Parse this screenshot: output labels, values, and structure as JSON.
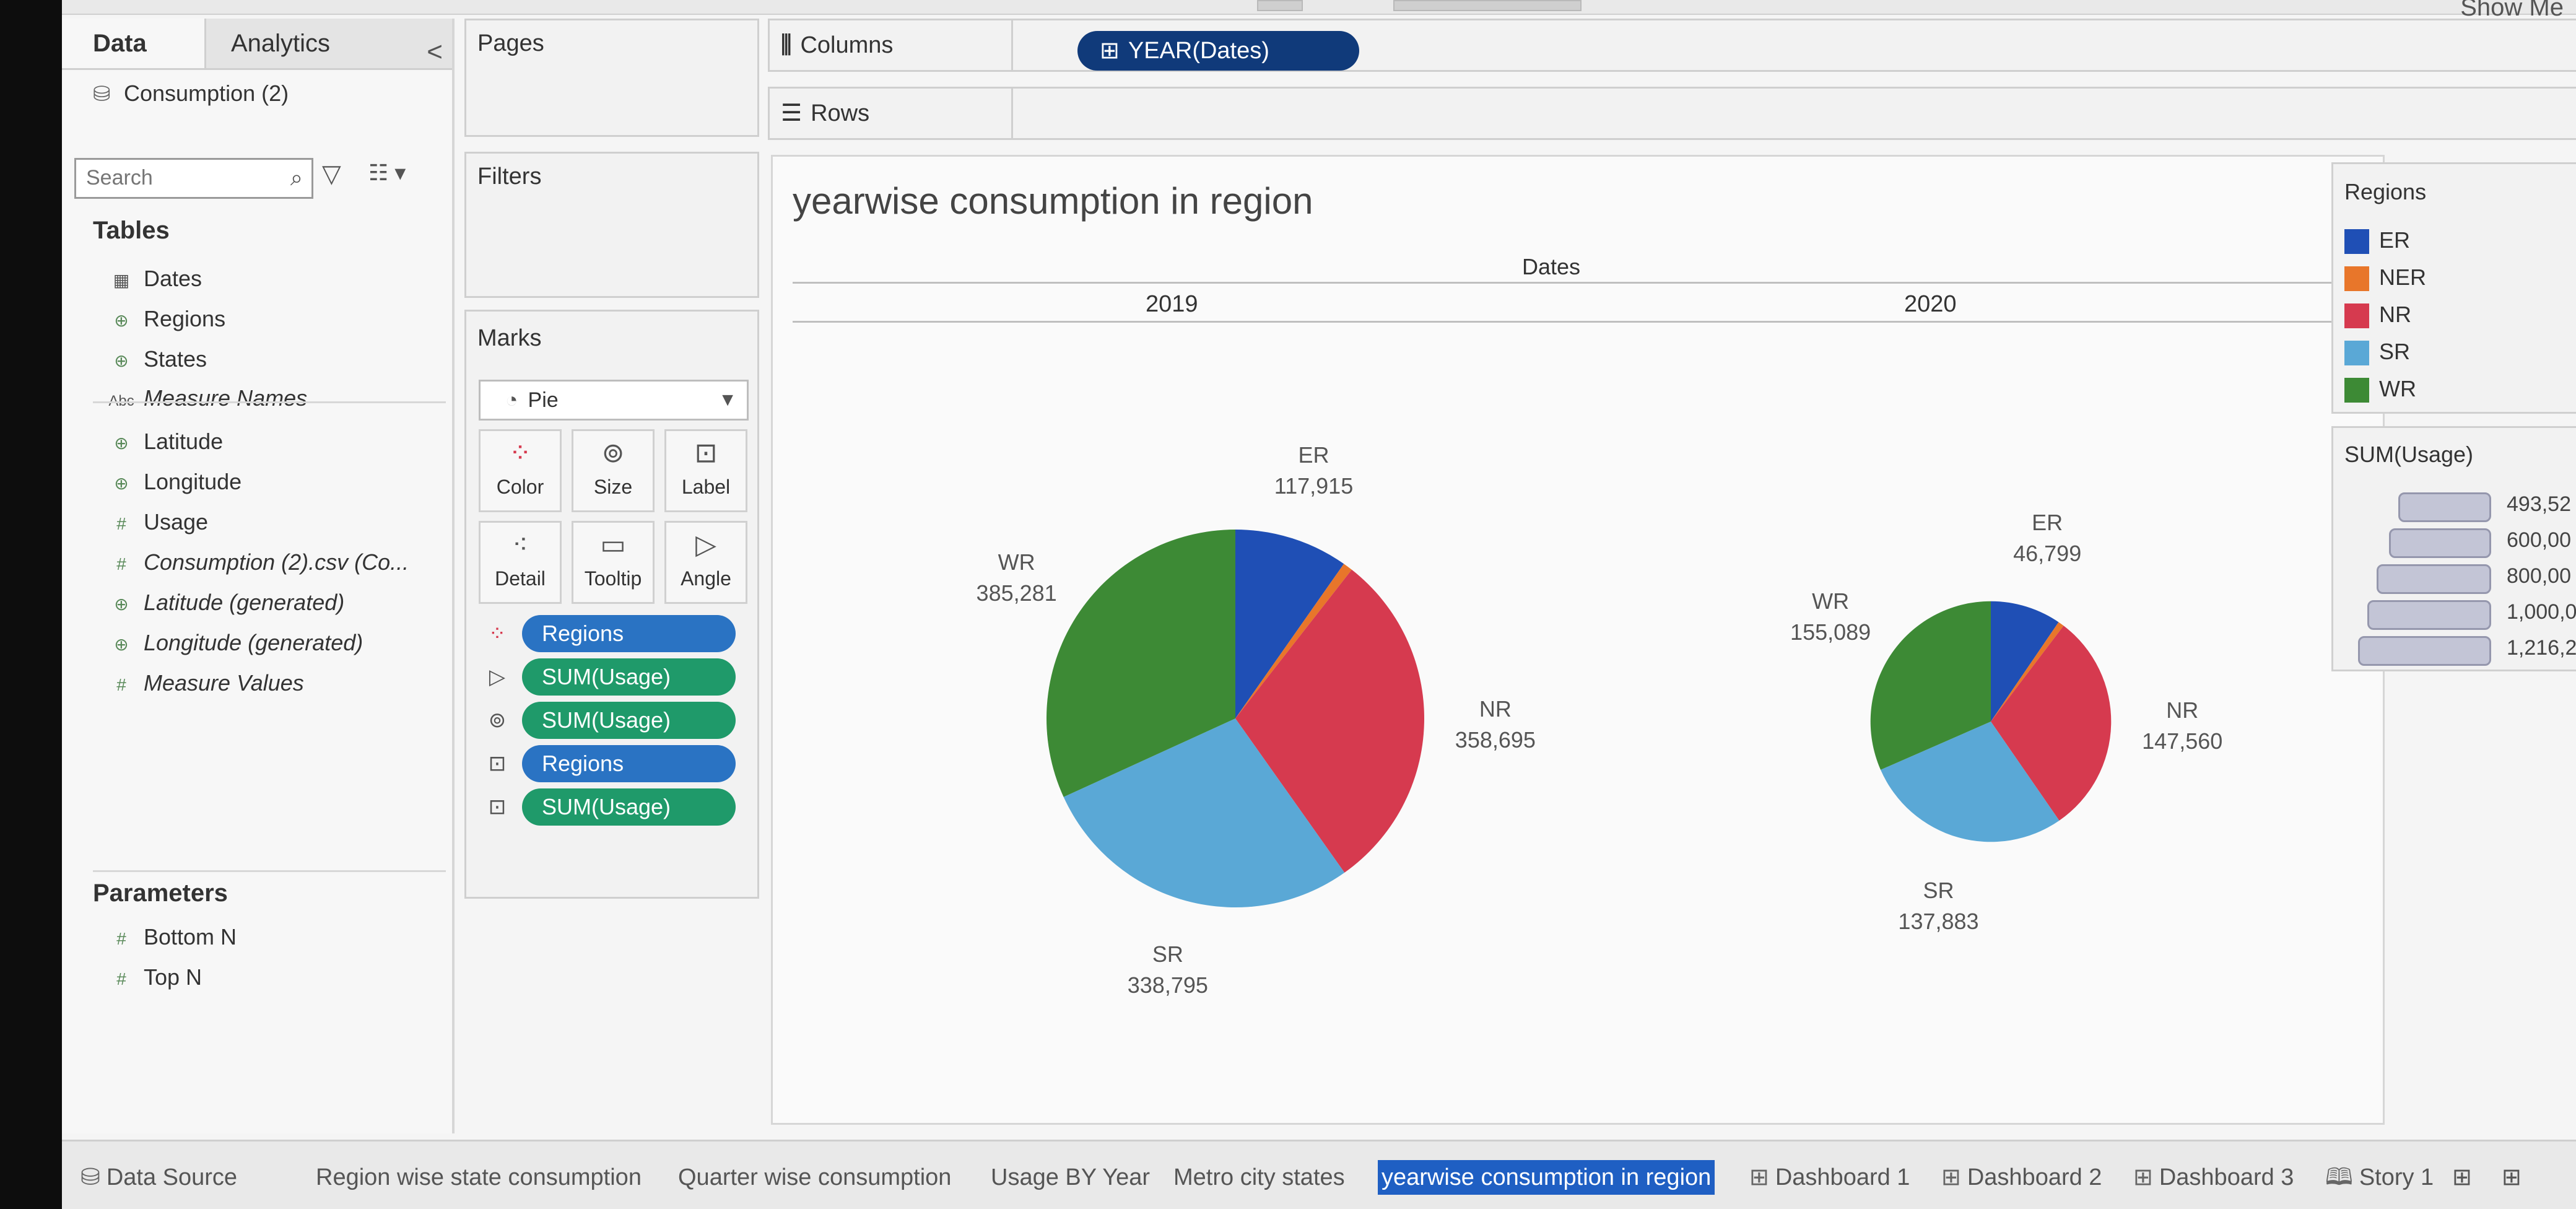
{
  "data_pane": {
    "tab_data": "Data",
    "tab_analytics": "Analytics",
    "collapse": "<",
    "datasource": "Consumption (2)",
    "search_placeholder": "Search",
    "tables_heading": "Tables",
    "fields": [
      {
        "icon": "calendar-icon",
        "label": "Dates"
      },
      {
        "icon": "globe-icon",
        "label": "Regions"
      },
      {
        "icon": "globe-icon",
        "label": "States"
      },
      {
        "icon": "abc-icon",
        "label": "Measure Names"
      },
      {
        "icon": "globe-icon",
        "label": "Latitude"
      },
      {
        "icon": "globe-icon",
        "label": "Longitude"
      },
      {
        "icon": "hash-icon",
        "label": "Usage"
      },
      {
        "icon": "hash-icon",
        "label": "Consumption (2).csv (Co..."
      },
      {
        "icon": "globe-icon",
        "label": "Latitude (generated)"
      },
      {
        "icon": "globe-icon",
        "label": "Longitude (generated)"
      },
      {
        "icon": "hash-icon",
        "label": "Measure Values"
      }
    ],
    "parameters_heading": "Parameters",
    "parameters": [
      "Bottom N",
      "Top N"
    ]
  },
  "cards": {
    "pages": "Pages",
    "filters": "Filters",
    "marks": "Marks",
    "mark_type": "Pie",
    "mark_buttons": [
      "Color",
      "Size",
      "Label",
      "Detail",
      "Tooltip",
      "Angle"
    ],
    "mark_pills": [
      {
        "icon": "color-icon",
        "label": "Regions",
        "color": "#2a73c3"
      },
      {
        "icon": "angle-icon",
        "label": "SUM(Usage)",
        "color": "#1f9a6a"
      },
      {
        "icon": "size-icon",
        "label": "SUM(Usage)",
        "color": "#1f9a6a"
      },
      {
        "icon": "label-icon",
        "label": "Regions",
        "color": "#2a73c3"
      },
      {
        "icon": "label-icon",
        "label": "SUM(Usage)",
        "color": "#1f9a6a"
      }
    ]
  },
  "shelves": {
    "columns_label": "Columns",
    "rows_label": "Rows",
    "columns_pill": "YEAR(Dates)"
  },
  "viz": {
    "title": "yearwise consumption in region",
    "column_header": "Dates"
  },
  "colors": {
    "ER": "#1f4fb5",
    "NER": "#e8762a",
    "NR": "#d63a4f",
    "SR": "#5aa8d6",
    "WR": "#3d8a35"
  },
  "chart_data": {
    "type": "pie",
    "group_by": "Dates",
    "pies": [
      {
        "year": "2019",
        "slices": [
          {
            "region": "ER",
            "value": 117915,
            "label": "117,915"
          },
          {
            "region": "NER",
            "value": 10000,
            "label": ""
          },
          {
            "region": "NR",
            "value": 358695,
            "label": "358,695"
          },
          {
            "region": "SR",
            "value": 338795,
            "label": "338,795"
          },
          {
            "region": "WR",
            "value": 385281,
            "label": "385,281"
          }
        ]
      },
      {
        "year": "2020",
        "slices": [
          {
            "region": "ER",
            "value": 46799,
            "label": "46,799"
          },
          {
            "region": "NER",
            "value": 4000,
            "label": ""
          },
          {
            "region": "NR",
            "value": 147560,
            "label": "147,560"
          },
          {
            "region": "SR",
            "value": 137883,
            "label": "137,883"
          },
          {
            "region": "WR",
            "value": 155089,
            "label": "155,089"
          }
        ]
      }
    ]
  },
  "legend": {
    "title": "Regions",
    "items": [
      "ER",
      "NER",
      "NR",
      "SR",
      "WR"
    ]
  },
  "size_legend": {
    "title": "SUM(Usage)",
    "items": [
      "493,52",
      "600,00",
      "800,00",
      "1,000,00",
      "1,216,20"
    ]
  },
  "sheet_tabs": [
    {
      "label": "Data Source",
      "active": false,
      "icon": "database-icon"
    },
    {
      "label": "Region wise state consumption",
      "active": false
    },
    {
      "label": "Quarter wise consumption",
      "active": false
    },
    {
      "label": "Usage BY Year",
      "active": false
    },
    {
      "label": "Metro city states",
      "active": false
    },
    {
      "label": "yearwise consumption in region",
      "active": true
    },
    {
      "label": "Dashboard 1",
      "active": false,
      "icon": "dashboard-icon"
    },
    {
      "label": "Dashboard 2",
      "active": false,
      "icon": "dashboard-icon"
    },
    {
      "label": "Dashboard 3",
      "active": false,
      "icon": "dashboard-icon"
    },
    {
      "label": "Story 1",
      "active": false,
      "icon": "story-icon"
    }
  ],
  "toolbar": {
    "show_me": "Show Me"
  }
}
